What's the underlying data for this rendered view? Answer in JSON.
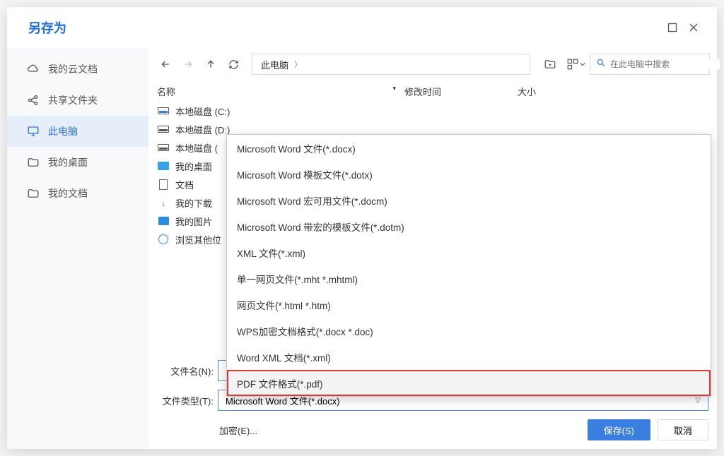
{
  "title": "另存为",
  "sidebar": {
    "items": [
      {
        "label": "我的云文档",
        "icon": "cloud"
      },
      {
        "label": "共享文件夹",
        "icon": "share"
      },
      {
        "label": "此电脑",
        "icon": "monitor",
        "active": true
      },
      {
        "label": "我的桌面",
        "icon": "folder"
      },
      {
        "label": "我的文档",
        "icon": "folder"
      }
    ]
  },
  "breadcrumb": {
    "root": "此电脑"
  },
  "search": {
    "placeholder": "在此电脑中搜索"
  },
  "columns": {
    "name": "名称",
    "modified": "修改时间",
    "size": "大小"
  },
  "files": [
    {
      "label": "本地磁盘 (C:)",
      "icon": "disk"
    },
    {
      "label": "本地磁盘 (D:)",
      "icon": "disk-dark"
    },
    {
      "label": "本地磁盘 (",
      "icon": "disk-dark"
    },
    {
      "label": "我的桌面",
      "icon": "desktop"
    },
    {
      "label": "文档",
      "icon": "doc"
    },
    {
      "label": "我的下载",
      "icon": "download"
    },
    {
      "label": "我的图片",
      "icon": "picture"
    },
    {
      "label": "浏览其他位",
      "icon": "globe"
    }
  ],
  "form": {
    "filename_label": "文件名(N):",
    "filetype_label": "文件类型(T):",
    "filetype_value": "Microsoft Word 文件(*.docx)",
    "encrypt_label": "加密(E)...",
    "save_label": "保存(S)",
    "cancel_label": "取消"
  },
  "dropdown": {
    "items": [
      "Microsoft Word 文件(*.docx)",
      "Microsoft Word 模板文件(*.dotx)",
      "Microsoft Word 宏可用文件(*.docm)",
      "Microsoft Word 带宏的模板文件(*.dotm)",
      "XML 文件(*.xml)",
      "单一网页文件(*.mht *.mhtml)",
      "网页文件(*.html *.htm)",
      "WPS加密文档格式(*.docx *.doc)",
      "Word XML 文档(*.xml)",
      "PDF 文件格式(*.pdf)"
    ],
    "highlight_index": 9
  }
}
